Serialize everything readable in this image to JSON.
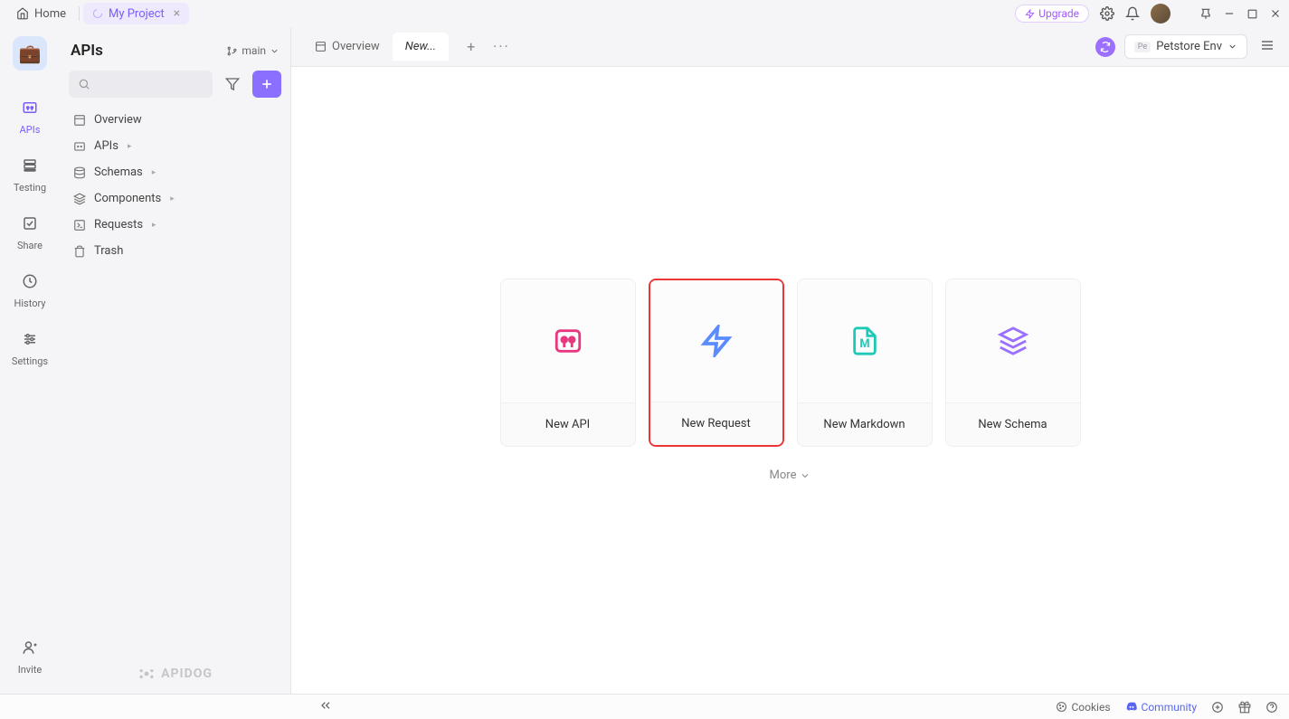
{
  "titlebar": {
    "home_label": "Home",
    "project_label": "My Project",
    "upgrade_label": "Upgrade"
  },
  "nav_rail": {
    "items": [
      {
        "label": "APIs"
      },
      {
        "label": "Testing"
      },
      {
        "label": "Share"
      },
      {
        "label": "History"
      },
      {
        "label": "Settings"
      }
    ],
    "invite_label": "Invite"
  },
  "sidebar": {
    "title": "APIs",
    "branch": "main",
    "tree": [
      {
        "label": "Overview"
      },
      {
        "label": "APIs"
      },
      {
        "label": "Schemas"
      },
      {
        "label": "Components"
      },
      {
        "label": "Requests"
      },
      {
        "label": "Trash"
      }
    ],
    "footer_brand": "APIDOG"
  },
  "content": {
    "tabs": [
      {
        "label": "Overview"
      },
      {
        "label": "New..."
      }
    ],
    "env_label": "Petstore Env",
    "env_badge": "Pe",
    "cards": [
      {
        "label": "New API"
      },
      {
        "label": "New Request"
      },
      {
        "label": "New Markdown"
      },
      {
        "label": "New Schema"
      }
    ],
    "more_label": "More"
  },
  "statusbar": {
    "cookies_label": "Cookies",
    "community_label": "Community"
  }
}
